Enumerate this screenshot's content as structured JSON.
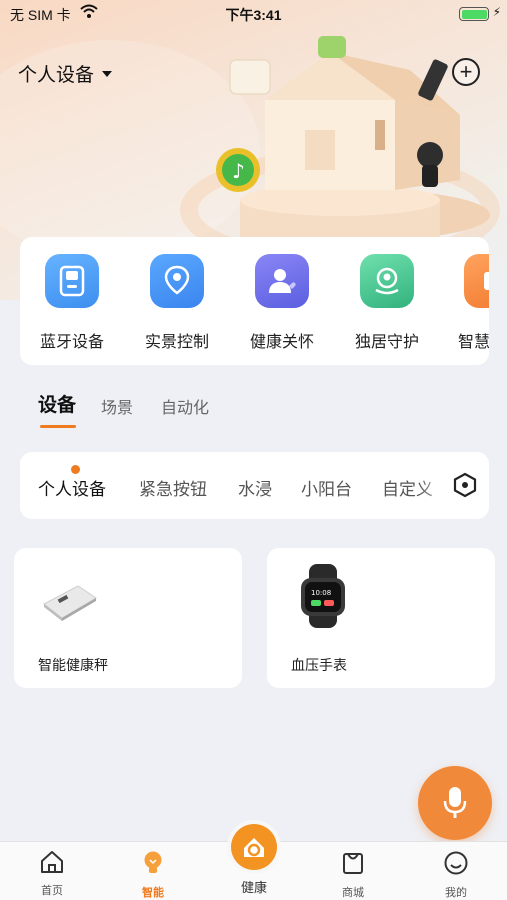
{
  "status_bar": {
    "carrier": "无 SIM 卡",
    "time": "下午3:41"
  },
  "header": {
    "device_selector": "个人设备"
  },
  "quick_actions": [
    {
      "label": "蓝牙设备",
      "icon": "bluetooth-device-icon",
      "color": "#4a9bf2"
    },
    {
      "label": "实景控制",
      "icon": "location-pin-icon",
      "color": "#3f8ef0"
    },
    {
      "label": "健康关怀",
      "icon": "person-heart-icon",
      "color": "#6c6fe8"
    },
    {
      "label": "独居守护",
      "icon": "guardian-icon",
      "color": "#3fc08e"
    },
    {
      "label": "智慧",
      "icon": "smart-icon",
      "color": "#f58a3a"
    }
  ],
  "tabs": [
    "设备",
    "场景",
    "自动化"
  ],
  "rooms": [
    "个人设备",
    "紧急按钮",
    "水浸",
    "小阳台",
    "自定义"
  ],
  "devices": [
    {
      "name": "智能健康秤",
      "icon": "smart-scale-icon"
    },
    {
      "name": "血压手表",
      "icon": "smartwatch-icon"
    }
  ],
  "bottom_nav": {
    "home": "首页",
    "smart": "智能",
    "health": "健康",
    "mall": "商城",
    "mine": "我的"
  },
  "colors": {
    "accent": "#f07a1e",
    "background": "#eef0f5"
  }
}
